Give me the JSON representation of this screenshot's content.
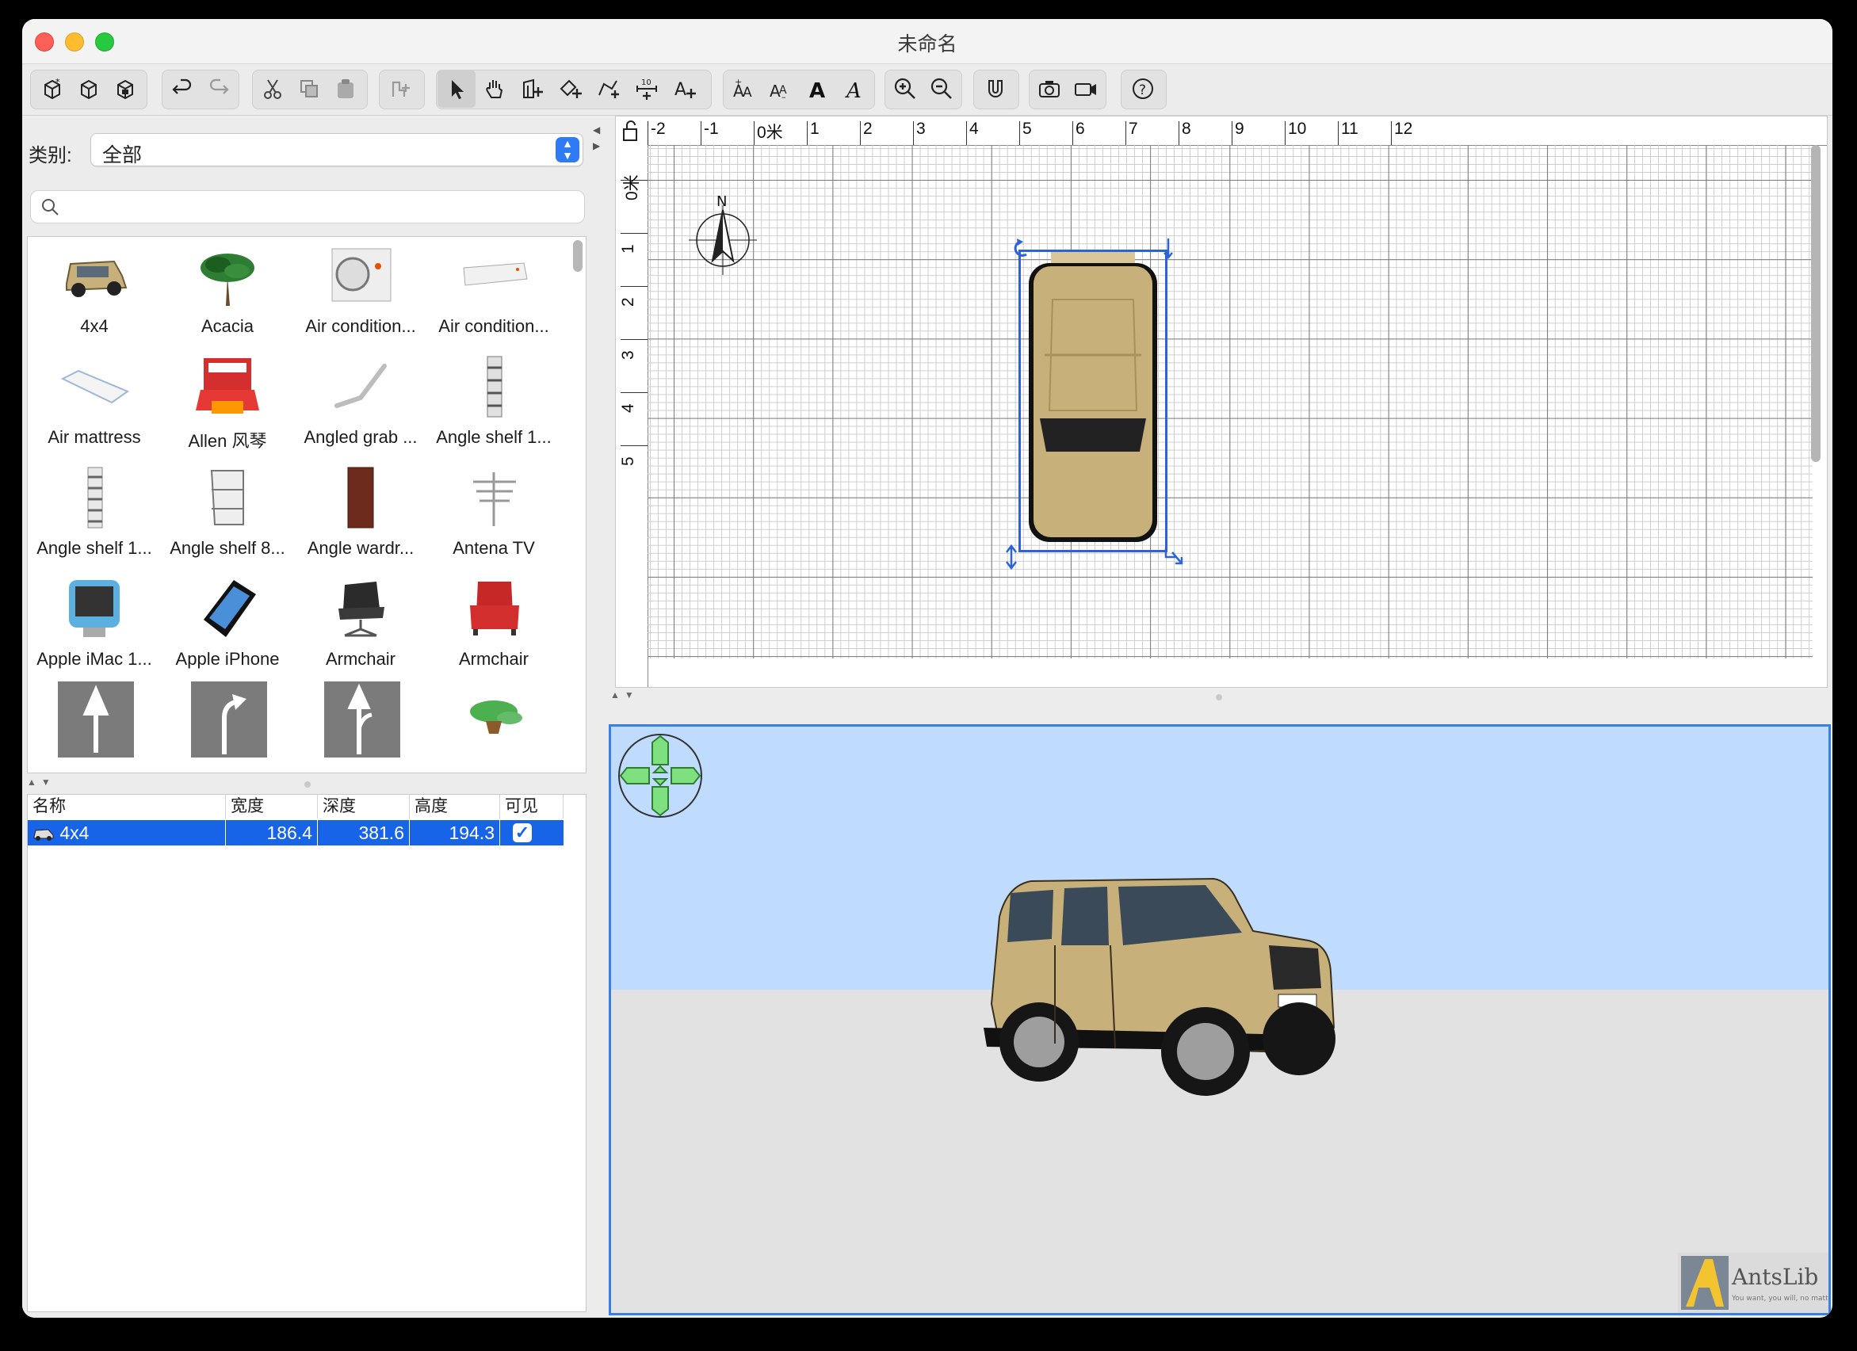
{
  "window": {
    "title": "未命名"
  },
  "catalog": {
    "category_label": "类别:",
    "category_value": "全部",
    "search_placeholder": "",
    "items": [
      {
        "name": "4x4"
      },
      {
        "name": "Acacia"
      },
      {
        "name": "Air condition..."
      },
      {
        "name": "Air condition..."
      },
      {
        "name": "Air mattress"
      },
      {
        "name": "Allen 风琴"
      },
      {
        "name": "Angled grab ..."
      },
      {
        "name": "Angle shelf 1..."
      },
      {
        "name": "Angle shelf 1..."
      },
      {
        "name": "Angle shelf 8..."
      },
      {
        "name": "Angle wardr..."
      },
      {
        "name": "Antena TV"
      },
      {
        "name": "Apple iMac 1..."
      },
      {
        "name": "Apple iPhone"
      },
      {
        "name": "Armchair"
      },
      {
        "name": "Armchair"
      },
      {
        "name": ""
      },
      {
        "name": ""
      },
      {
        "name": ""
      },
      {
        "name": ""
      }
    ]
  },
  "furniture_table": {
    "headers": {
      "name": "名称",
      "width": "宽度",
      "depth": "深度",
      "height": "高度",
      "visible": "可见"
    },
    "rows": [
      {
        "name": "4x4",
        "width": "186.4",
        "depth": "381.6",
        "height": "194.3",
        "visible": true
      }
    ]
  },
  "plan": {
    "ruler_x": [
      "-2",
      "-1",
      "0米",
      "1",
      "2",
      "3",
      "4",
      "5",
      "6",
      "7",
      "8",
      "9",
      "10",
      "11",
      "12"
    ],
    "ruler_y": [
      "0米",
      "1",
      "2",
      "3",
      "4",
      "5"
    ],
    "compass_label": "N"
  },
  "toolbar": {
    "text_style_icons": [
      "AA+",
      "AA-",
      "A",
      "A"
    ]
  },
  "watermark": {
    "text": "AntsLib",
    "tagline": "You want, you will, no matter what"
  },
  "colors": {
    "selection": "#1864e8",
    "accent": "#2f7bf5",
    "sky": "#bfdcff",
    "ground": "#e2e2e2",
    "car": "#c8b07a"
  }
}
